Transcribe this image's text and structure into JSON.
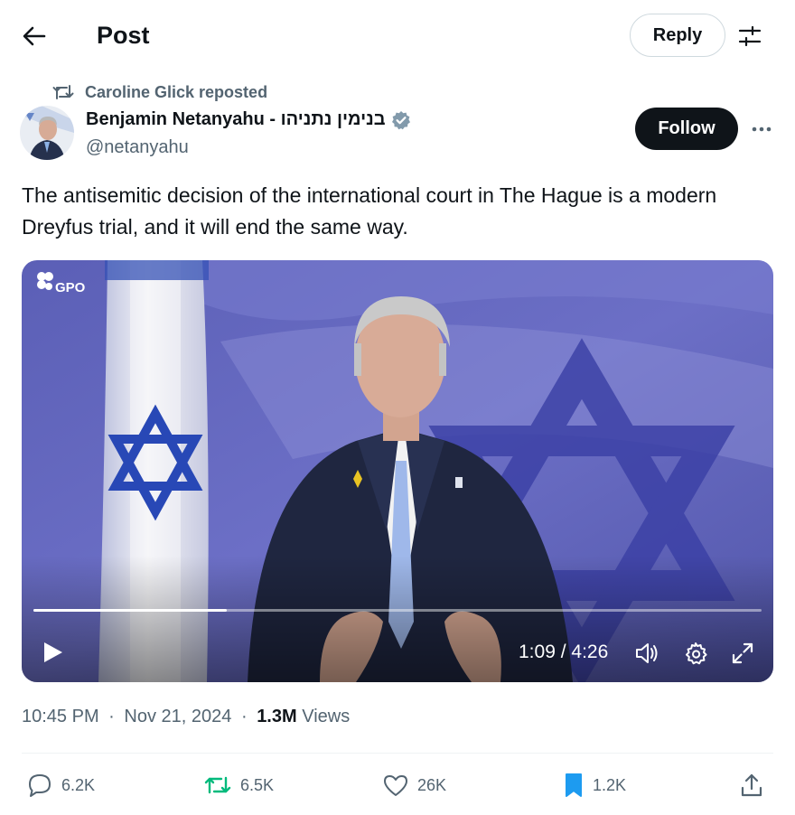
{
  "header": {
    "title": "Post",
    "reply_label": "Reply",
    "back_icon": "arrow-left-icon",
    "settings_icon": "sliders-icon"
  },
  "repost": {
    "text": "Caroline Glick reposted",
    "icon": "repost-icon"
  },
  "author": {
    "name": "Benjamin Netanyahu - בנימין נתניהו",
    "handle": "@netanyahu",
    "verified": true,
    "follow_label": "Follow"
  },
  "post": {
    "text": "The antisemitic decision of the international court in The Hague is a modern Dreyfus trial, and it will end the same way."
  },
  "video": {
    "watermark": "GPO",
    "current_time": "1:09",
    "duration": "4:26",
    "time_separator": " / ",
    "progress_fraction": 0.265
  },
  "meta": {
    "time": "10:45 PM",
    "date": "Nov 21, 2024",
    "views_count": "1.3M",
    "views_label": "Views",
    "separator": "·"
  },
  "actions": {
    "replies": "6.2K",
    "reposts": "6.5K",
    "likes": "26K",
    "bookmarks": "1.2K"
  },
  "colors": {
    "text_primary": "#0f1419",
    "text_secondary": "#536471",
    "repost_active": "#00ba7c",
    "bookmark_active": "#1d9bf0",
    "verified_badge": "#829aab",
    "follow_button_bg": "#0f1419"
  }
}
